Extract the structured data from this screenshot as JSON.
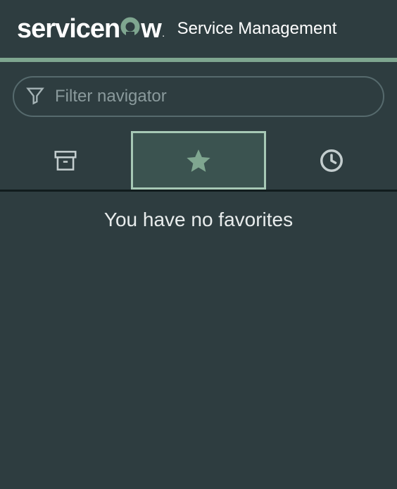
{
  "header": {
    "brand_prefix": "servicen",
    "brand_suffix": "w",
    "brand_dot": ".",
    "title": "Service Management"
  },
  "search": {
    "placeholder": "Filter navigator",
    "value": ""
  },
  "tabs": {
    "active_index": 1
  },
  "main": {
    "empty_message": "You have no favorites"
  },
  "colors": {
    "background": "#2e3d40",
    "accent": "#7fa690",
    "active_tab_bg": "#3b5350",
    "active_tab_border": "#a6c8b5"
  }
}
